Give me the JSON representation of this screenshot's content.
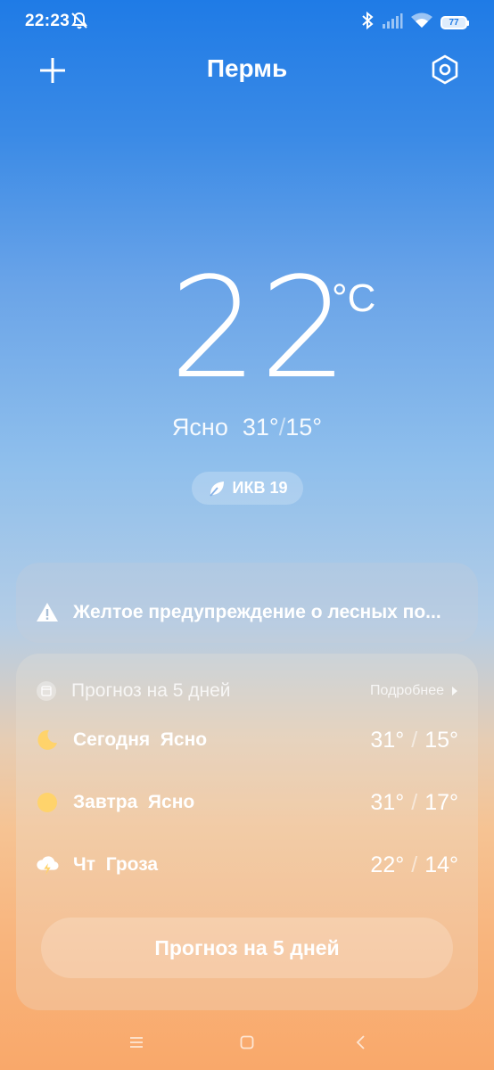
{
  "status_bar": {
    "time": "22:23",
    "battery": "77",
    "icons": [
      "bell-off-icon",
      "bluetooth-icon",
      "signal-icon",
      "wifi-icon",
      "battery-icon"
    ]
  },
  "header": {
    "city": "Пермь",
    "add_icon": "plus-icon",
    "settings_icon": "settings-icon"
  },
  "current": {
    "temperature": "22",
    "unit": "°C",
    "condition": "Ясно",
    "high": "31°",
    "low": "15°",
    "separator": "/",
    "aqi_label": "ИКВ 19",
    "aqi_icon": "leaf-icon"
  },
  "warning": {
    "text": "Желтое предупреждение о лесных по...",
    "icon": "warning-icon"
  },
  "forecast": {
    "title": "Прогноз на 5 дней",
    "more_label": "Подробнее",
    "button_label": "Прогноз на 5 дней",
    "days": [
      {
        "label": "Сегодня  Ясно",
        "icon": "moon-icon",
        "high": "31°",
        "low": "15°"
      },
      {
        "label": "Завтра  Ясно",
        "icon": "sun-icon",
        "high": "31°",
        "low": "17°"
      },
      {
        "label": "Чт  Гроза",
        "icon": "thunderstorm-icon",
        "high": "22°",
        "low": "14°"
      }
    ]
  },
  "colors": {
    "sky_top": "#1f7be6",
    "sky_bottom": "#f9a86a",
    "sun": "#ffd36b"
  }
}
